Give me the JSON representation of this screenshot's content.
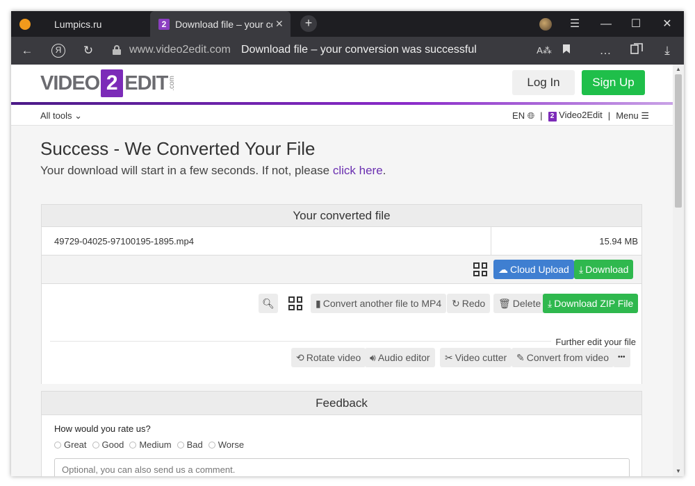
{
  "browser": {
    "tabs": [
      {
        "label": "Lumpics.ru"
      },
      {
        "label": "Download file – your conversion was successful",
        "close": "✕"
      }
    ],
    "new_tab": "+",
    "url_host": "www.video2edit.com",
    "url_title": "Download file – your conversion was successful",
    "yandex_letter": "Я"
  },
  "header": {
    "logo_left": "VIDEO",
    "logo_two": "2",
    "logo_right": "EDIT",
    "logo_com": ".com",
    "login": "Log In",
    "signup": "Sign Up"
  },
  "subnav": {
    "all_tools": "All tools",
    "lang": "EN",
    "sep": "|",
    "brand": "Video2Edit",
    "brand_badge": "2",
    "menu": "Menu"
  },
  "main": {
    "title": "Success - We Converted Your File",
    "subtitle_before": "Your download will start in a few seconds. If not, please ",
    "subtitle_link": "click here",
    "subtitle_after": "."
  },
  "converted": {
    "heading": "Your converted file",
    "filename": "49729-04025-97100195-1895.mp4",
    "size": "15.94 MB",
    "cloud_upload": "Cloud Upload",
    "download": "Download",
    "convert_another": "Convert another file to MP4",
    "redo": "Redo",
    "delete": "Delete",
    "download_zip": "Download ZIP File",
    "further": "Further edit your file",
    "rotate": "Rotate video",
    "audio_editor": "Audio editor",
    "video_cutter": "Video cutter",
    "convert_from_video": "Convert from video",
    "more": "•••"
  },
  "feedback": {
    "heading": "Feedback",
    "question": "How would you rate us?",
    "options": [
      "Great",
      "Good",
      "Medium",
      "Bad",
      "Worse"
    ],
    "comment_placeholder": "Optional, you can also send us a comment."
  },
  "colors": {
    "brand_purple": "#7c2bb8",
    "signup_green": "#1fbf4a",
    "cloud_blue": "#3f7fd1",
    "download_green": "#2fb84e"
  }
}
